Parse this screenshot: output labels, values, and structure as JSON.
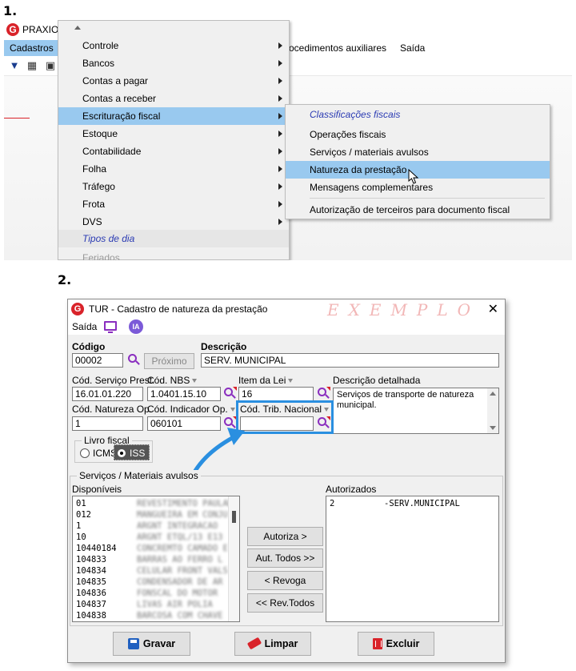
{
  "steps": {
    "one": "1.",
    "two": "2."
  },
  "panel1": {
    "app_title": "PRAXIO",
    "menubar": [
      {
        "label": "Cadastros"
      },
      {
        "label": "rocedimentos auxiliares"
      },
      {
        "label": "Saída"
      }
    ],
    "menu_cadastros": [
      {
        "label": "Controle"
      },
      {
        "label": "Bancos"
      },
      {
        "label": "Contas a pagar"
      },
      {
        "label": "Contas a receber"
      },
      {
        "label": "Escrituração fiscal"
      },
      {
        "label": "Estoque"
      },
      {
        "label": "Contabilidade"
      },
      {
        "label": "Folha"
      },
      {
        "label": "Tráfego"
      },
      {
        "label": "Frota"
      },
      {
        "label": "DVS"
      },
      {
        "label": "Tipos de dia"
      },
      {
        "label": "Feriados"
      }
    ],
    "submenu_fiscal": [
      {
        "label": "Classificações fiscais"
      },
      {
        "label": "Operações fiscais"
      },
      {
        "label": "Serviços / materiais avulsos"
      },
      {
        "label": "Natureza da prestação"
      },
      {
        "label": "Mensagens complementares"
      },
      {
        "label": "Autorização de terceiros para documento fiscal"
      }
    ]
  },
  "dialog": {
    "title": "TUR - Cadastro de natureza da prestação",
    "watermark": "EXEMPLO",
    "menu_saida": "Saída",
    "ia_badge": "IA",
    "labels": {
      "codigo": "Código",
      "descricao": "Descrição",
      "cod_servico_prest": "Cód. Serviço Prest.",
      "cod_nbs": "Cód. NBS",
      "item_da_lei": "Item da Lei",
      "descricao_detalhada": "Descrição detalhada",
      "cod_natureza_op": "Cód. Natureza Op.",
      "cod_indicador_op": "Cód. Indicador Op.",
      "cod_trib_nacional": "Cód. Trib. Nacional",
      "livro_fiscal": "Livro fiscal",
      "icms": "ICMS",
      "iss": "ISS",
      "servicos_materiais": "Serviços / Materiais avulsos",
      "disponiveis": "Disponíveis",
      "autorizados": "Autorizados"
    },
    "values": {
      "codigo": "00002",
      "descricao": "SERV. MUNICIPAL",
      "cod_servico_prest": "16.01.01.220",
      "cod_nbs": "1.0401.15.10",
      "item_da_lei": "16",
      "descricao_detalhada": "Serviços de transporte de natureza municipal.",
      "cod_natureza_op": "1",
      "cod_indicador_op": "060101",
      "cod_trib_nacional": ""
    },
    "buttons": {
      "proximo": "Próximo",
      "autoriza": "Autoriza >",
      "aut_todos": "Aut. Todos >>",
      "revoga": "< Revoga",
      "rev_todos": "<< Rev.Todos",
      "gravar": "Gravar",
      "limpar": "Limpar",
      "excluir": "Excluir"
    },
    "disponiveis": [
      {
        "code": "01",
        "desc": "REVESTIMENTO PAULADO"
      },
      {
        "code": "012",
        "desc": "MANGUEIRA EM CONJU"
      },
      {
        "code": "1",
        "desc": "ARGNT INTEGRACAO"
      },
      {
        "code": "10",
        "desc": "ARGNT ETQL/13 E13"
      },
      {
        "code": "10440184",
        "desc": "CONCREMTO CAMADO E"
      },
      {
        "code": "104833",
        "desc": "BARRAS AO FERRO L"
      },
      {
        "code": "104834",
        "desc": "CELULAR FRONT VALS"
      },
      {
        "code": "104835",
        "desc": "CONDENSADOR DE AR"
      },
      {
        "code": "104836",
        "desc": "FONSCAL DO MOTOR"
      },
      {
        "code": "104837",
        "desc": "LIVAS AIR  POLIA"
      },
      {
        "code": "104838",
        "desc": "BARCOSA COM CHAVE"
      }
    ],
    "autorizados": [
      {
        "code": "2",
        "desc": "-SERV.MUNICIPAL"
      }
    ],
    "livro_fiscal_selected": "ISS",
    "accent": "#2a8fe0",
    "brand": "#d9232a"
  }
}
